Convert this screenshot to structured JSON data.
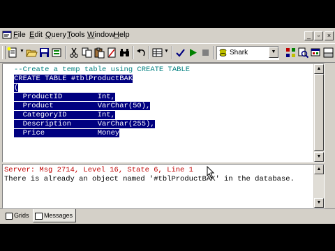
{
  "menubar": {
    "items": [
      "File",
      "Edit",
      "Query",
      "Tools",
      "Window",
      "Help"
    ],
    "underline": [
      "F",
      "E",
      "Q",
      "T",
      "W",
      "H"
    ]
  },
  "window_controls": {
    "minimize": "_",
    "restore": "▫",
    "close": "×"
  },
  "toolbar": {
    "buttons": [
      "new-query",
      "open",
      "save",
      "insert-template",
      "cut",
      "copy",
      "paste",
      "clear",
      "find",
      "undo",
      "results-mode",
      "parse",
      "execute",
      "cancel-execution",
      "object-browser",
      "object-search",
      "current-connection-properties"
    ]
  },
  "database_select": {
    "value": "Shark"
  },
  "editor": {
    "lines": [
      {
        "text": "--Create a temp table using CREATE TABLE",
        "kind": "comment"
      },
      {
        "text": "CREATE TABLE #tblProductBAK",
        "kind": "selected"
      },
      {
        "text": "(",
        "kind": "selected"
      },
      {
        "text": "  ProductID        Int,",
        "kind": "selected"
      },
      {
        "text": "  Product          VarChar(50),",
        "kind": "selected"
      },
      {
        "text": "  CategoryID       Int,",
        "kind": "selected"
      },
      {
        "text": "  Description      VarChar(255),",
        "kind": "selected"
      },
      {
        "text": "  Price            Money",
        "kind": "selected"
      }
    ]
  },
  "results": {
    "error": "Server: Msg 2714, Level 16, State 6, Line 1",
    "message": "There is already an object named '#tblProductBAK' in the database."
  },
  "tabs": [
    {
      "label": "Grids",
      "active": false
    },
    {
      "label": "Messages",
      "active": true
    }
  ]
}
